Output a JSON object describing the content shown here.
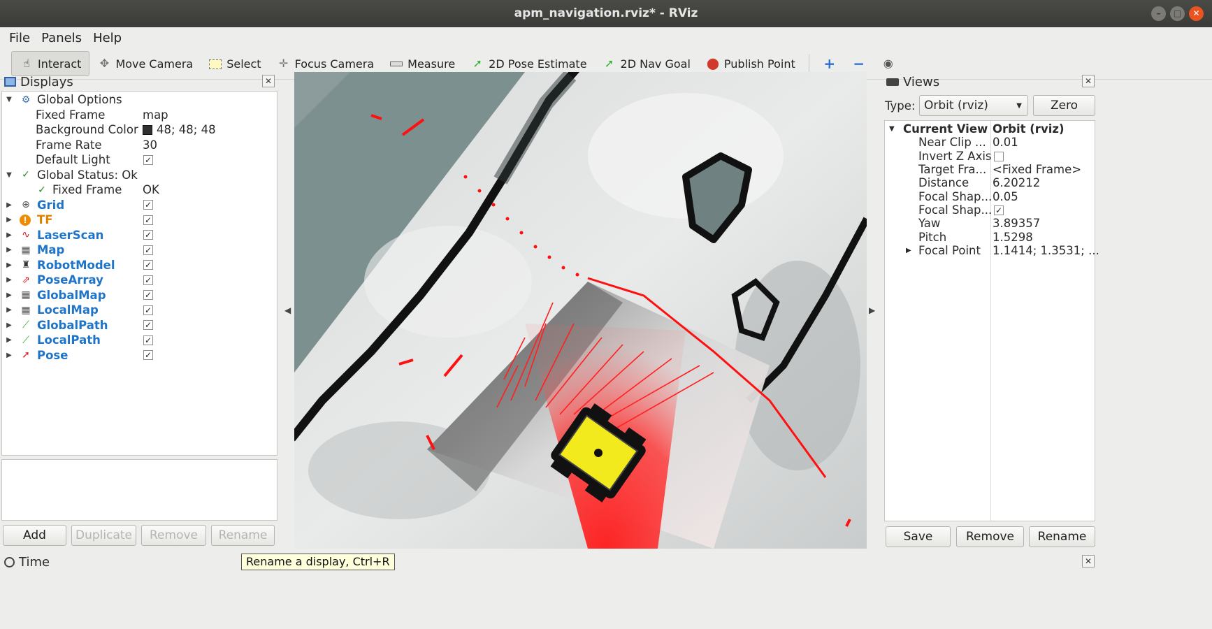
{
  "window": {
    "title": "apm_navigation.rviz* - RViz"
  },
  "menu": {
    "file": "File",
    "panels": "Panels",
    "help": "Help"
  },
  "toolbar": {
    "interact": "Interact",
    "move_camera": "Move Camera",
    "select": "Select",
    "focus_camera": "Focus Camera",
    "measure": "Measure",
    "pose_estimate": "2D Pose Estimate",
    "nav_goal": "2D Nav Goal",
    "publish_point": "Publish Point"
  },
  "displays": {
    "title": "Displays",
    "global_options": "Global Options",
    "fixed_frame_label": "Fixed Frame",
    "fixed_frame_value": "map",
    "bg_color_label": "Background Color",
    "bg_color_value": "48; 48; 48",
    "bg_color_hex": "#303030",
    "frame_rate_label": "Frame Rate",
    "frame_rate_value": "30",
    "default_light_label": "Default Light",
    "global_status": "Global Status: Ok",
    "status_fixed_frame_label": "Fixed Frame",
    "status_fixed_frame_value": "OK",
    "items": [
      {
        "label": "Grid",
        "icon": "grid-icon",
        "checked": true
      },
      {
        "label": "TF",
        "icon": "warning-icon",
        "checked": true
      },
      {
        "label": "LaserScan",
        "icon": "laserscan-icon",
        "checked": true
      },
      {
        "label": "Map",
        "icon": "map-icon",
        "checked": true
      },
      {
        "label": "RobotModel",
        "icon": "robot-icon",
        "checked": true
      },
      {
        "label": "PoseArray",
        "icon": "posearray-icon",
        "checked": true
      },
      {
        "label": "GlobalMap",
        "icon": "map-icon",
        "checked": true
      },
      {
        "label": "LocalMap",
        "icon": "map-icon",
        "checked": true
      },
      {
        "label": "GlobalPath",
        "icon": "path-icon",
        "checked": true
      },
      {
        "label": "LocalPath",
        "icon": "path-icon",
        "checked": true
      },
      {
        "label": "Pose",
        "icon": "pose-icon",
        "checked": true
      }
    ],
    "buttons": {
      "add": "Add",
      "duplicate": "Duplicate",
      "remove": "Remove",
      "rename": "Rename"
    }
  },
  "views": {
    "title": "Views",
    "type_label": "Type:",
    "type_value": "Orbit (rviz)",
    "zero": "Zero",
    "current_view_label": "Current View",
    "current_view_value": "Orbit (rviz)",
    "props": [
      {
        "label": "Near Clip ...",
        "value": "0.01"
      },
      {
        "label": "Invert Z Axis",
        "value": ""
      },
      {
        "label": "Target Fra...",
        "value": "<Fixed Frame>"
      },
      {
        "label": "Distance",
        "value": "6.20212"
      },
      {
        "label": "Focal Shap...",
        "value": "0.05"
      },
      {
        "label": "Focal Shap...",
        "value": ""
      },
      {
        "label": "Yaw",
        "value": "3.89357"
      },
      {
        "label": "Pitch",
        "value": "1.5298"
      },
      {
        "label": "Focal Point",
        "value": "1.1414; 1.3531; ..."
      }
    ],
    "buttons": {
      "save": "Save",
      "remove": "Remove",
      "rename": "Rename"
    }
  },
  "time_panel": {
    "title": "Time"
  },
  "tooltip": "Rename a display, Ctrl+R"
}
